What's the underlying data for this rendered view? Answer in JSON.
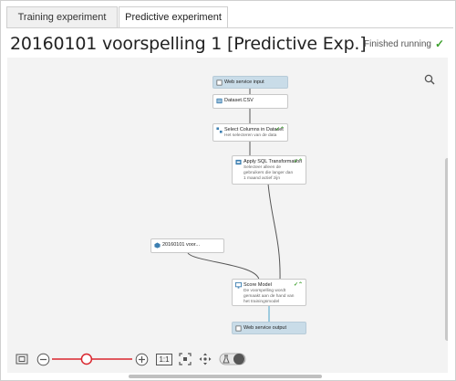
{
  "tabs": [
    {
      "label": "Training experiment",
      "active": false
    },
    {
      "label": "Predictive experiment",
      "active": true
    }
  ],
  "experiment": {
    "title": "20160101 voorspelling 1 [Predictive Exp.]",
    "status": "Finished running"
  },
  "modules": {
    "web_input": {
      "title": "Web service input"
    },
    "dataset": {
      "title": "Dataset.CSV"
    },
    "select_columns": {
      "title": "Select Columns in Dataset",
      "description": "Het selecteren van de data"
    },
    "apply_sql": {
      "title": "Apply SQL Transformation",
      "description": "Selecteer alleen de gebruikers die langer dan 1 maand actief zijn"
    },
    "trained_model": {
      "title": "20160101 voor..."
    },
    "score_model": {
      "title": "Score Model",
      "description": "De voorspelling wordt gemaakt aan de hand van het trainingsmodel"
    },
    "web_output": {
      "title": "Web service output"
    }
  },
  "zoom": {
    "actual_size_label": "1:1",
    "level": 0.42
  },
  "colors": {
    "success": "#3a9f2a",
    "zoom_accent": "#d9262e",
    "io_module": "#c9dce8"
  },
  "icons": {
    "status": "check-icon",
    "search": "search-icon",
    "fit": "fit-to-screen-icon",
    "zoom_out": "zoom-out-icon",
    "zoom_in": "zoom-in-icon",
    "pan": "pan-icon",
    "minimap": "minimap-toggle-icon"
  }
}
